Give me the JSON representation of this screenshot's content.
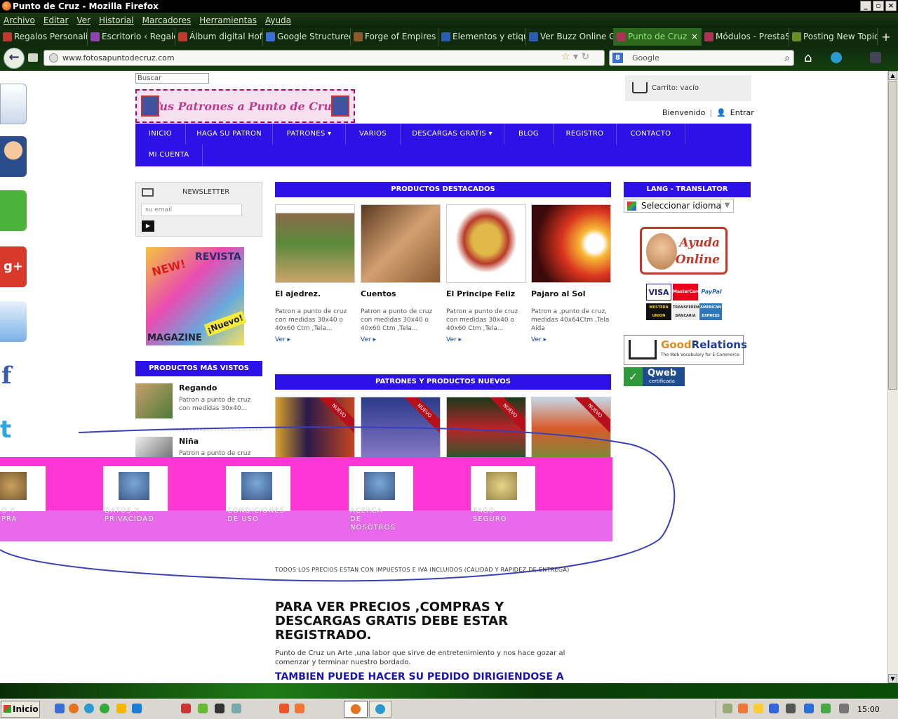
{
  "window": {
    "title": "Punto de Cruz - Mozilla Firefox"
  },
  "menu": [
    "Archivo",
    "Editar",
    "Ver",
    "Historial",
    "Marcadores",
    "Herramientas",
    "Ayuda"
  ],
  "tabs": [
    {
      "label": "Regalos Personaliz...",
      "color": "#c0392b"
    },
    {
      "label": "Escritorio ‹ Regalo...",
      "color": "#8e44ad"
    },
    {
      "label": "Álbum digital Hofm...",
      "color": "#c0392b"
    },
    {
      "label": "Google Structured...",
      "color": "#3a6fd8"
    },
    {
      "label": "Forge of Empires",
      "color": "#8b5a2b"
    },
    {
      "label": "Elementos y etiqu...",
      "color": "#2a5db0"
    },
    {
      "label": "Ver Buzz Online Gr...",
      "color": "#2a5db0"
    },
    {
      "label": "Punto de Cruz",
      "color": "#aa3355",
      "active": true
    },
    {
      "label": "Módulos - PrestaS...",
      "color": "#aa3355"
    },
    {
      "label": "Posting New Topic...",
      "color": "#6b8e23"
    }
  ],
  "nav": {
    "url": "www.fotosapuntodecruz.com",
    "search_placeholder": "Google",
    "back_label": "←"
  },
  "page": {
    "search_placeholder": "Buscar",
    "logo_text": "Tus Patrones a Punto de Cruz",
    "cart_text": "Carrito: vacío",
    "welcome": "Bienvenido",
    "login": "Entrar",
    "main_nav": [
      "INICIO",
      "HAGA SU PATRON",
      "PATRONES ▾",
      "VARIOS",
      "DESCARGAS GRATIS ▾",
      "BLOG",
      "REGISTRO",
      "CONTACTO",
      "MI CUENTA"
    ],
    "newsletter": {
      "title": "NEWSLETTER",
      "placeholder": "su email",
      "button": "▶"
    },
    "magazine": {
      "top": "REVISTA",
      "new": "NEW!",
      "bottom": "MAGAZINE",
      "badge": "¡Nuevo!"
    },
    "most_viewed": {
      "title": "PRODUCTOS MÁS VISTOS",
      "items": [
        {
          "name": "Regando",
          "desc": "Patron a punto de cruz con medidas 30x40..."
        },
        {
          "name": "Niña",
          "desc": "Patron a punto de cruz"
        }
      ]
    },
    "featured": {
      "title": "PRODUCTOS DESTACADOS",
      "items": [
        {
          "name": "El ajedrez.",
          "desc": "Patron a punto de cruz con medidas 30x40 o 40x60 Ctm ,Tela...",
          "more": "Ver ▸"
        },
        {
          "name": "Cuentos",
          "desc": "Patron a punto de cruz con medidas 30x40 o 40x60 Ctm ,Tela...",
          "more": "Ver ▸"
        },
        {
          "name": "El Principe Feliz",
          "desc": "Patron a punto de cruz con medidas 30x40 o 40x60 Ctm ,Tela...",
          "more": "Ver ▸"
        },
        {
          "name": "Pajaro al Sol",
          "desc": "Patron a ,punto de cruz, medidas 40x64Ctm ,Tela Aida",
          "more": "Ver ▸"
        }
      ]
    },
    "new_products": {
      "title": "PATRONES Y PRODUCTOS NUEVOS",
      "badge": "NUEVO"
    },
    "lang": {
      "title": "LANG - TRANSLATOR",
      "select": "Seleccionar idioma"
    },
    "help": {
      "line1": "Ayuda",
      "line2": "Online"
    },
    "payments": [
      "VISA",
      "MasterCard",
      "PayPal",
      "WESTERN UNION",
      "TRANSFERENCIA BANCARIA",
      "AMERICAN EXPRESS"
    ],
    "goodrelations": {
      "title_a": "Good",
      "title_b": "Relations",
      "sub": "The Web Vocabulary for E-Commerce"
    },
    "qweb": {
      "title": "Qweb",
      "sub": "certificada"
    },
    "footer_links": [
      {
        "label": "O Y\nPRA"
      },
      {
        "label": "DATOS Y\nPRIVACIDAD"
      },
      {
        "label": "CONDICIONES\nDE USO"
      },
      {
        "label": "ACERCA\nDE\nNOSOTROS"
      },
      {
        "label": "PAGO\nSEGURO"
      }
    ],
    "notice": "TODOS LOS PRECIOS ESTAN CON IMPUESTOS E IVA INCLUIDOS (CALIDAD Y RAPIDEZ DE ENTREGA)",
    "big_message": "PARA VER PRECIOS ,COMPRAS Y DESCARGAS GRATIS DEBE ESTAR REGISTRADO.",
    "intro": "Punto de Cruz un Arte ,una labor que sirve de entretenimiento y nos hace gozar al comenzar y terminar nuestro bordado.",
    "tambien": "TAMBIEN PUEDE HACER SU PEDIDO DIRIGIENDOSE A"
  },
  "taskbar": {
    "start": "Inicio",
    "clock": "15:00"
  }
}
